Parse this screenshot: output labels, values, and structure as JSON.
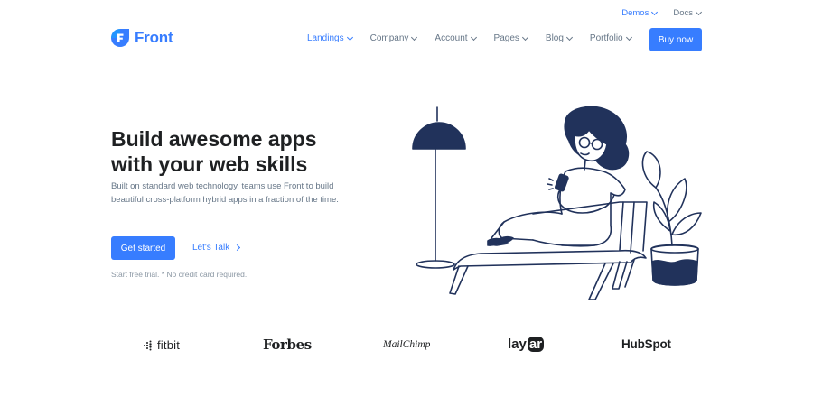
{
  "topbar": {
    "links": [
      {
        "label": "Demos",
        "active": true
      },
      {
        "label": "Docs",
        "active": false
      }
    ]
  },
  "brand": {
    "name": "Front",
    "icon": "front-logo-icon",
    "color": "#377dff"
  },
  "nav": {
    "items": [
      {
        "label": "Landings",
        "active": true
      },
      {
        "label": "Company",
        "active": false
      },
      {
        "label": "Account",
        "active": false
      },
      {
        "label": "Pages",
        "active": false
      },
      {
        "label": "Blog",
        "active": false
      },
      {
        "label": "Portfolio",
        "active": false
      }
    ],
    "cta": "Buy now"
  },
  "hero": {
    "title_line1": "Build awesome apps",
    "title_line2": "with your web skills",
    "subtitle": "Built on standard web technology, teams use Front to build beautiful cross-platform hybrid apps in a fraction of the time.",
    "primary_button": "Get started",
    "secondary_link": "Let's Talk",
    "note": "Start free trial. * No credit card required."
  },
  "clients": {
    "fitbit": "fitbit",
    "forbes": "Forbes",
    "mailchimp": "MailChimp",
    "layar_a": "lay",
    "layar_b": "ar",
    "hubspot": "HubSpot"
  },
  "colors": {
    "accent": "#377dff",
    "dark": "#1e2022",
    "muted": "#677788",
    "illustration": "#21325b"
  }
}
